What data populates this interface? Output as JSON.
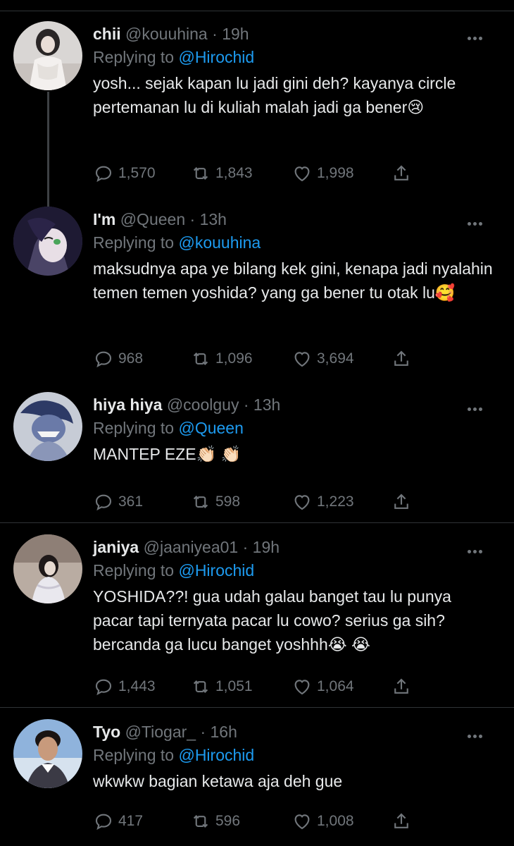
{
  "tweets": [
    {
      "name": "chii",
      "handle": "@kouuhina",
      "time": "19h",
      "replying_label": "Replying to",
      "replying_to": "@Hirochid",
      "text": "yosh... sejak kapan lu jadi gini deh? kayanya circle pertemanan lu di kuliah malah jadi ga bener",
      "emoji": "😢",
      "replies": "1,570",
      "retweets": "1,843",
      "likes": "1,998"
    },
    {
      "name": "I'm",
      "handle": "@Queen",
      "time": "13h",
      "replying_label": "Replying to",
      "replying_to": "@kouuhina",
      "text": "maksudnya apa ye bilang kek gini, kenapa jadi nyalahin temen temen yoshida? yang ga bener tu otak lu",
      "emoji": "🥰",
      "replies": "968",
      "retweets": "1,096",
      "likes": "3,694"
    },
    {
      "name": "hiya hiya",
      "handle": "@coolguy",
      "time": "13h",
      "replying_label": "Replying to",
      "replying_to": "@Queen",
      "text": "MANTEP EZE",
      "emoji": "👏🏻 👏🏻",
      "replies": "361",
      "retweets": "598",
      "likes": "1,223"
    },
    {
      "name": "janiya",
      "handle": "@jaaniyea01",
      "time": "19h",
      "replying_label": "Replying to",
      "replying_to": "@Hirochid",
      "text": "YOSHIDA??! gua udah galau banget tau lu punya pacar tapi ternyata pacar lu cowo? serius ga sih? bercanda ga lucu banget yoshhh",
      "emoji": "😭 😭",
      "replies": "1,443",
      "retweets": "1,051",
      "likes": "1,064"
    },
    {
      "name": "Tyo",
      "handle": "@Tiogar_",
      "time": "16h",
      "replying_label": "Replying to",
      "replying_to": "@Hirochid",
      "text": "wkwkw bagian ketawa aja deh gue",
      "emoji": "",
      "replies": "417",
      "retweets": "596",
      "likes": "1,008"
    }
  ]
}
